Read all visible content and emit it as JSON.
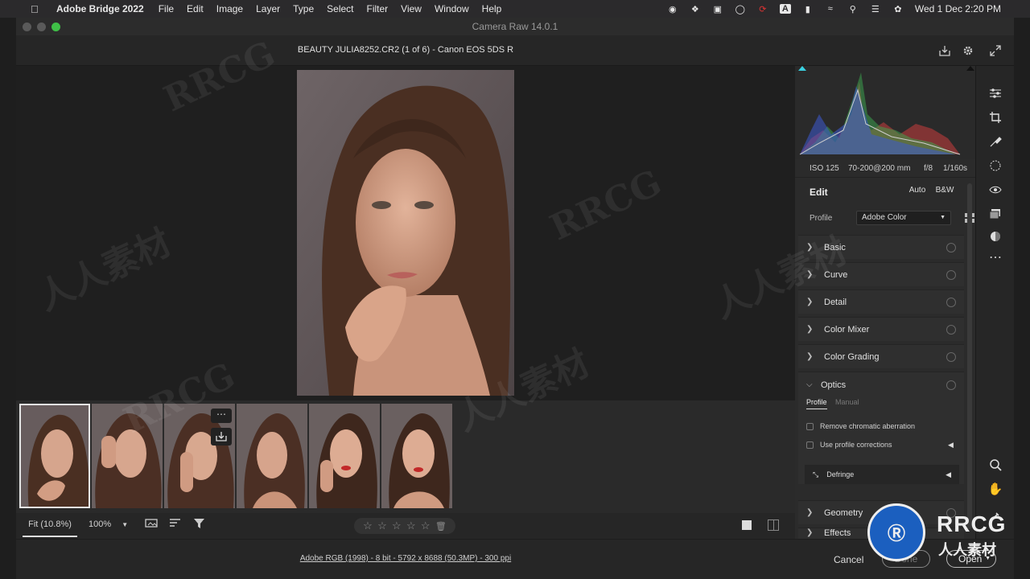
{
  "menubar": {
    "app_name": "Adobe Bridge 2022",
    "items": [
      "File",
      "Edit",
      "Image",
      "Layer",
      "Type",
      "Select",
      "Filter",
      "View",
      "Window",
      "Help"
    ],
    "clock": "Wed 1 Dec  2:20 PM",
    "status_icons": [
      "record-icon",
      "dropbox-icon",
      "screen-icon",
      "creative-cloud-icon",
      "sync-icon",
      "keyboard-A-icon",
      "battery-icon",
      "wifi-icon",
      "search-icon",
      "control-center-icon",
      "siri-icon"
    ]
  },
  "window": {
    "title": "Camera Raw 14.0.1",
    "file_title": "BEAUTY JULIA8252.CR2 (1 of 6)  -  Canon EOS 5DS R"
  },
  "histogram": {
    "iso": "ISO 125",
    "lens": "70-200@200 mm",
    "aperture": "f/8",
    "shutter": "1/160s"
  },
  "edit_panel": {
    "title": "Edit",
    "auto_label": "Auto",
    "bw_label": "B&W",
    "profile_label": "Profile",
    "profile_value": "Adobe Color",
    "sections": [
      {
        "label": "Basic"
      },
      {
        "label": "Curve"
      },
      {
        "label": "Detail"
      },
      {
        "label": "Color Mixer"
      },
      {
        "label": "Color Grading"
      }
    ],
    "optics": {
      "label": "Optics",
      "tab_profile": "Profile",
      "tab_manual": "Manual",
      "remove_ca": "Remove chromatic aberration",
      "use_profile": "Use profile corrections",
      "defringe": "Defringe"
    },
    "geometry": "Geometry",
    "effects": "Effects"
  },
  "bottombar": {
    "fit_label": "Fit (10.8%)",
    "zoom_value": "100%",
    "rating_stars": 0
  },
  "statusline": {
    "file_info": "Adobe RGB (1998) - 8 bit - 5792 x 8688 (50.3MP) - 300 ppi",
    "cancel_label": "Cancel",
    "done_label": "Done",
    "open_label": "Open"
  },
  "watermarks": {
    "text_latin": "RRCG",
    "text_cjk": "人人素材"
  },
  "colors": {
    "accent_blue": "#1473e6",
    "panel": "#2b2b2b"
  }
}
